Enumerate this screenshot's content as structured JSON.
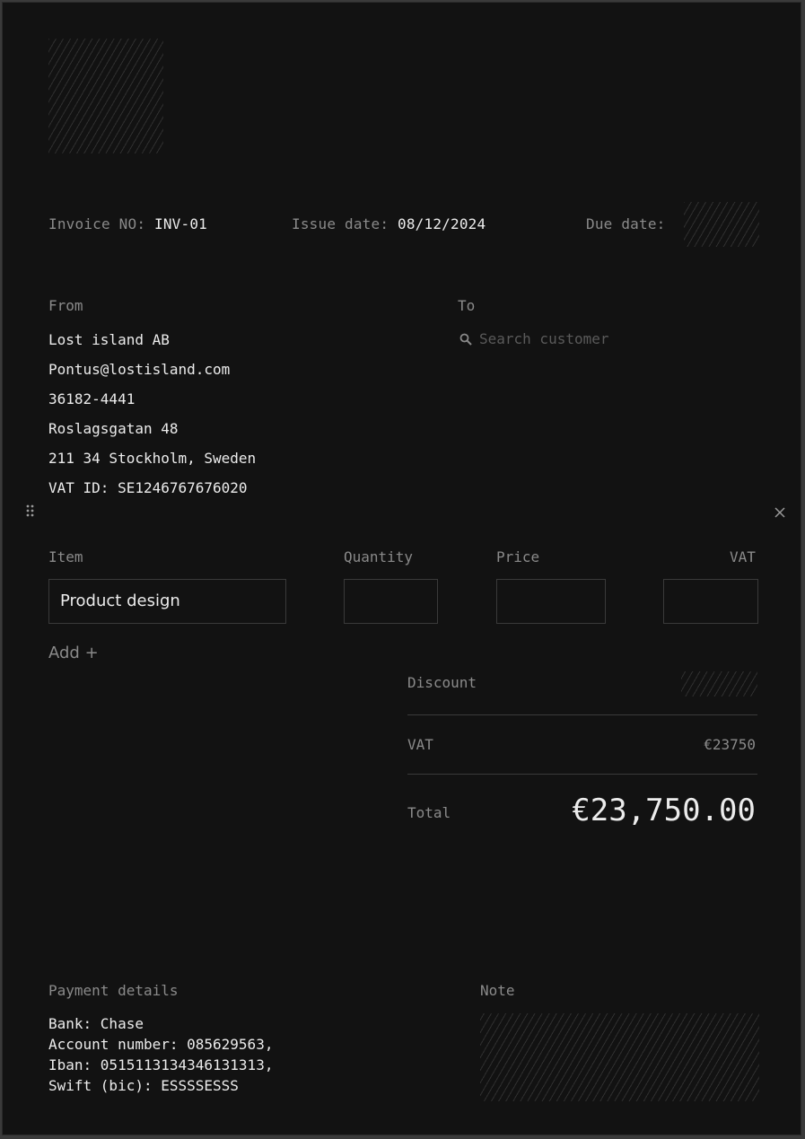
{
  "invoice": {
    "number_label": "Invoice NO:",
    "number_value": "INV-01",
    "issue_label": "Issue date:",
    "issue_value": "08/12/2024",
    "due_label": "Due date:"
  },
  "from": {
    "label": "From",
    "lines": [
      "Lost island AB",
      "Pontus@lostisland.com",
      "36182-4441",
      "Roslagsgatan 48",
      "211 34 Stockholm, Sweden",
      "VAT ID: SE1246767676020"
    ]
  },
  "to": {
    "label": "To",
    "search_placeholder": "Search customer",
    "search_icon": "search-icon"
  },
  "items": {
    "headers": {
      "item": "Item",
      "quantity": "Quantity",
      "price": "Price",
      "vat": "VAT"
    },
    "rows": [
      {
        "item": "Product design",
        "quantity": "",
        "price": "",
        "vat": ""
      }
    ],
    "add_label": "Add +"
  },
  "summary": {
    "discount_label": "Discount",
    "vat_label": "VAT",
    "vat_value": "€23750",
    "total_label": "Total",
    "total_value": "€23,750.00"
  },
  "payment": {
    "label": "Payment details",
    "lines": [
      "Bank: Chase",
      "Account number: 085629563,",
      "Iban: 0515113134346131313,",
      "Swift (bic): ESSSSESSS"
    ]
  },
  "note": {
    "label": "Note"
  },
  "icons": {
    "drag": "drag-handle-icon",
    "close": "close-icon"
  },
  "colors": {
    "background": "#121212",
    "text": "#ececec",
    "muted": "#8a8a8a",
    "border": "#3a3a3a"
  }
}
